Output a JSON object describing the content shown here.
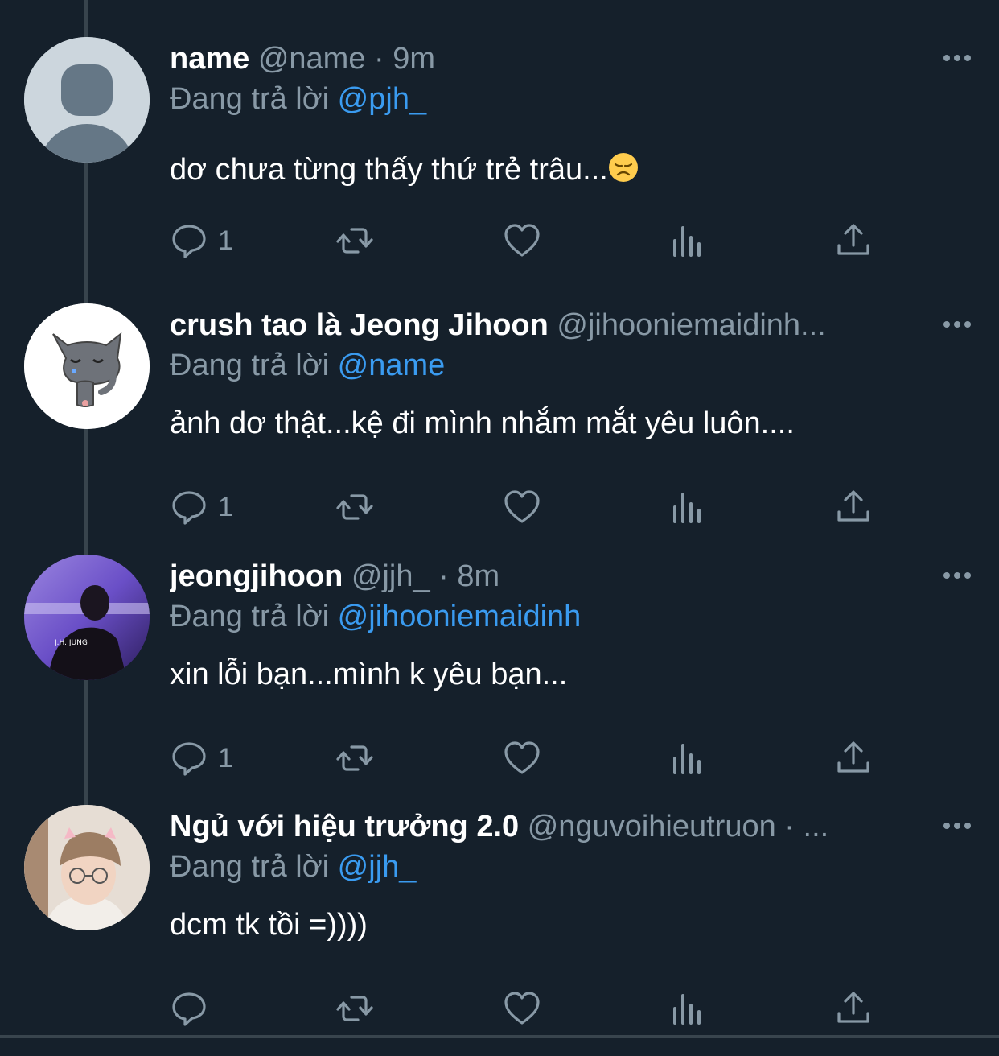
{
  "tweets": [
    {
      "display_name": "name",
      "handle": "@name",
      "separator": "·",
      "time": "9m",
      "reply_prefix": "Đang trả lời",
      "reply_to": "@pjh_",
      "text": "dơ chưa từng thấy thứ trẻ trâu...",
      "emoji": "disappointed-face",
      "reply_count": "1",
      "avatar": "default-avatar"
    },
    {
      "display_name": "crush tao là Jeong Jihoon",
      "handle": "@jihooniemaidinh...",
      "reply_prefix": "Đang trả lời",
      "reply_to": "@name",
      "text": "ảnh dơ thật...kệ đi mình nhắm mắt yêu luôn....",
      "reply_count": "1",
      "avatar": "crying-cat-avatar"
    },
    {
      "display_name": "jeongjihoon",
      "handle": "@jjh_",
      "separator": "·",
      "time": "8m",
      "reply_prefix": "Đang trả lời",
      "reply_to": "@jihooniemaidinh",
      "text": "xin lỗi bạn...mình k yêu bạn...",
      "reply_count": "1",
      "avatar": "photo-avatar-purple"
    },
    {
      "display_name": "Ngủ với hiệu trưởng 2.0",
      "handle": "@nguvoihieutruon",
      "separator": "·",
      "ellipsis": "...",
      "reply_prefix": "Đang trả lời",
      "reply_to": "@jjh_",
      "text": "dcm tk tồi =))))",
      "reply_count": "",
      "avatar": "photo-avatar-person"
    }
  ],
  "colors": {
    "background": "#15202b",
    "secondary_text": "#8899a6",
    "link": "#3a9bf0",
    "thread_line": "#38444d"
  }
}
